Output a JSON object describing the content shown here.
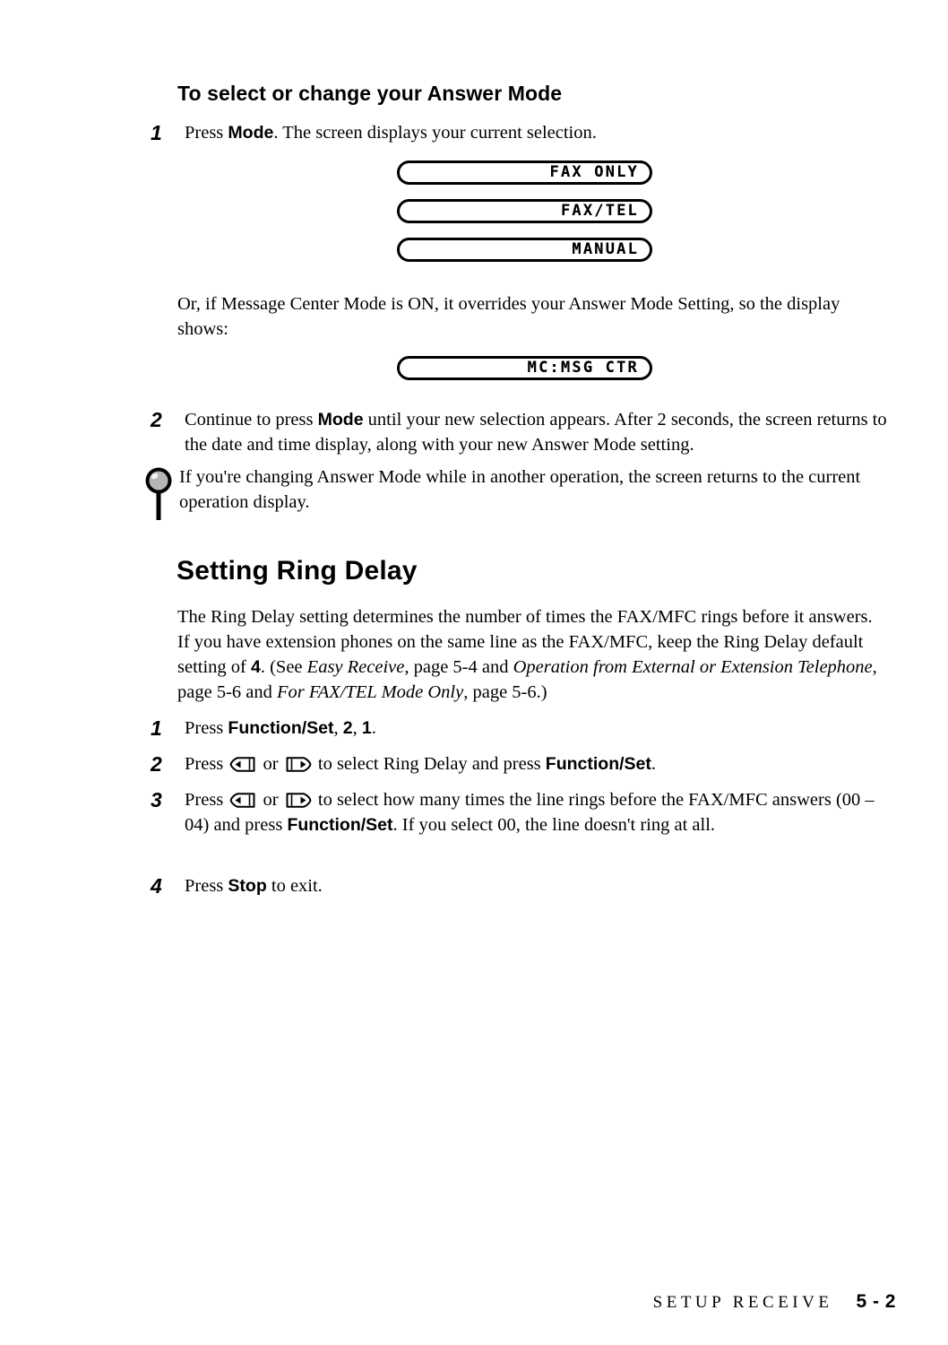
{
  "document": {
    "sub_heading": "To select or change your Answer Mode",
    "section_heading": "Setting Ring Delay"
  },
  "steps_answer_mode": [
    {
      "number": "1",
      "text_before": "Press ",
      "bold": "Mode",
      "text_after": ". The screen displays your current selection."
    },
    {
      "number": "2",
      "text_before": "Continue to press ",
      "bold": "Mode",
      "text_after": " until your new selection appears. After 2 seconds, the screen returns to the date and time display, along with your new Answer Mode setting."
    }
  ],
  "lcd_displays": {
    "answer_modes": [
      {
        "text": "FAX ONLY"
      },
      {
        "text": "FAX/TEL"
      },
      {
        "text": "MANUAL"
      }
    ],
    "message_center": {
      "text": "MC:MSG CTR"
    }
  },
  "paragraphs": {
    "override_note": "Or, if Message Center Mode is ON, it overrides your Answer Mode Setting, so the display shows:",
    "tip_note": "If you're changing Answer Mode while in another operation, the screen returns to the current operation display.",
    "ring_delay_intro": {
      "part1": "The Ring Delay setting determines the number of times the FAX/MFC rings before it answers.  If you have extension phones on the same line as the FAX/MFC, keep the Ring Delay default setting of ",
      "bold_value": "4",
      "part2": ". (See ",
      "italic1": "Easy Receive",
      "part3": ", page 5-4 and ",
      "italic2": "Operation from External or Extension Telephone",
      "part4": ", page 5-6 and ",
      "italic3": "For FAX/TEL Mode Only",
      "part5": ", page 5-6.)"
    }
  },
  "steps_ring_delay": [
    {
      "number": "1",
      "text_before": "Press ",
      "bold1": "Function/Set",
      "mid": ", ",
      "bold2": "2",
      "mid2": ", ",
      "bold3": "1",
      "text_after": "."
    },
    {
      "number": "2",
      "text_before": "Press ",
      "arrow_left": "left-arrow-key",
      "text_or": " or ",
      "arrow_right": "right-arrow-key",
      "text_mid": " to select Ring Delay and press ",
      "bold1": "Function/Set",
      "text_after": "."
    },
    {
      "number": "3",
      "text_before": "Press ",
      "arrow_left": "left-arrow-key",
      "text_or": " or ",
      "arrow_right": "right-arrow-key",
      "text_mid": " to select how many times the line rings before the FAX/MFC answers (00 – 04) and press ",
      "bold1": "Function/Set",
      "text_after": ". If you select 00, the line doesn't ring at all."
    },
    {
      "number": "4",
      "text_before": "Press ",
      "bold1": "Stop",
      "text_after": " to exit."
    }
  ],
  "footer": {
    "title": "SETUP RECEIVE",
    "page": "5 - 2"
  },
  "icons": {
    "note": "magnifier-icon",
    "arrow_left": "left-arrow-key-icon",
    "arrow_right": "right-arrow-key-icon"
  },
  "colors": {
    "text": "#000000",
    "background": "#ffffff",
    "icon_fill": "#b5b5b5"
  }
}
